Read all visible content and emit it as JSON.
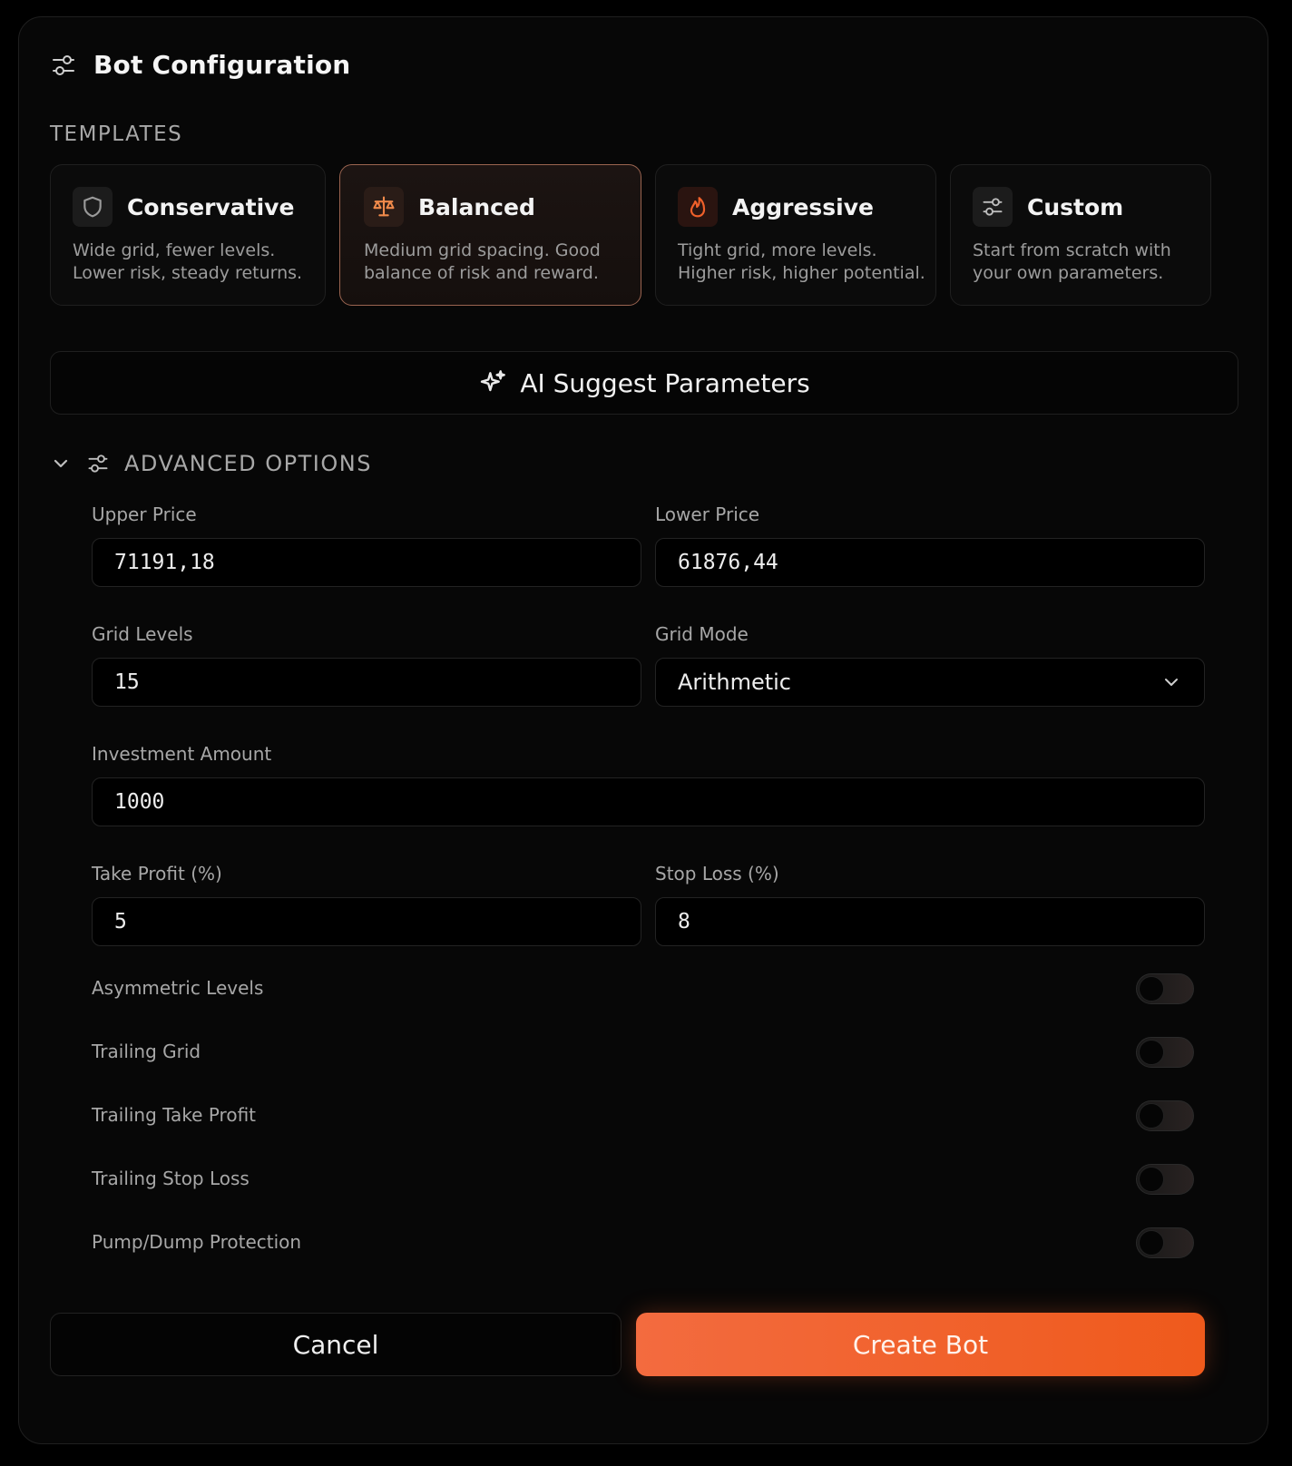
{
  "header": {
    "title": "Bot Configuration",
    "icon": "sliders-icon"
  },
  "templates": {
    "section_label": "TEMPLATES",
    "items": [
      {
        "name": "Conservative",
        "icon": "shield-icon",
        "desc_line1": "Wide grid, fewer levels.",
        "desc_line2": "Lower risk, steady returns.",
        "selected": false
      },
      {
        "name": "Balanced",
        "icon": "scale-icon",
        "desc_line1": "Medium grid spacing. Good",
        "desc_line2": "balance of risk and reward.",
        "selected": true
      },
      {
        "name": "Aggressive",
        "icon": "flame-icon",
        "desc_line1": "Tight grid, more levels.",
        "desc_line2": "Higher risk, higher potential.",
        "selected": false
      },
      {
        "name": "Custom",
        "icon": "sliders-icon",
        "desc_line1": "Start from scratch with",
        "desc_line2": "your own parameters.",
        "selected": false
      }
    ]
  },
  "ai_suggest": {
    "label": "AI Suggest Parameters",
    "icon": "sparkles-icon"
  },
  "advanced": {
    "label": "ADVANCED OPTIONS",
    "expanded": true,
    "fields": {
      "upper_price": {
        "label": "Upper Price",
        "value": "71191,18"
      },
      "lower_price": {
        "label": "Lower Price",
        "value": "61876,44"
      },
      "grid_levels": {
        "label": "Grid Levels",
        "value": "15"
      },
      "grid_mode": {
        "label": "Grid Mode",
        "value": "Arithmetic"
      },
      "investment": {
        "label": "Investment Amount",
        "value": "1000"
      },
      "take_profit": {
        "label": "Take Profit (%)",
        "value": "5"
      },
      "stop_loss": {
        "label": "Stop Loss (%)",
        "value": "8"
      }
    },
    "toggles": [
      {
        "label": "Asymmetric Levels",
        "on": false
      },
      {
        "label": "Trailing Grid",
        "on": false
      },
      {
        "label": "Trailing Take Profit",
        "on": false
      },
      {
        "label": "Trailing Stop Loss",
        "on": false
      },
      {
        "label": "Pump/Dump Protection",
        "on": false
      }
    ]
  },
  "actions": {
    "cancel": "Cancel",
    "create": "Create Bot"
  },
  "colors": {
    "accent": "#F0601F",
    "selected_border": "#9A6450",
    "panel_bg": "#070707"
  }
}
